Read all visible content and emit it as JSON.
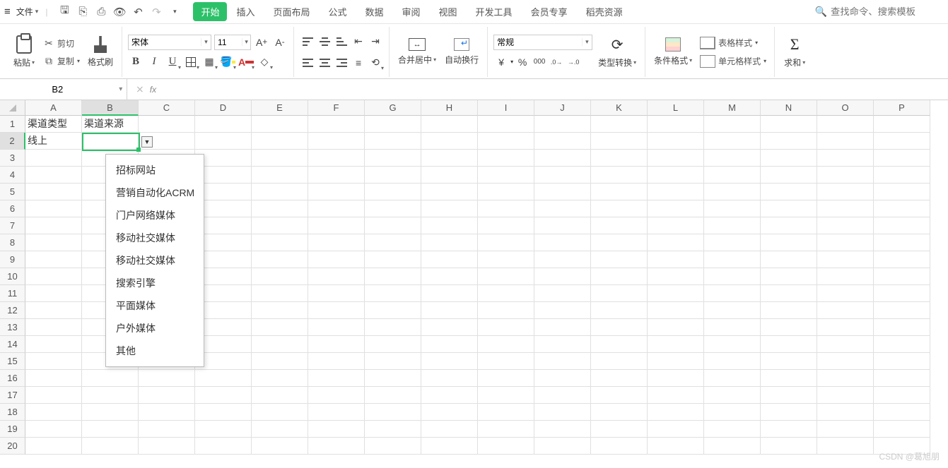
{
  "menu": {
    "file": "文件",
    "tabs": [
      "开始",
      "插入",
      "页面布局",
      "公式",
      "数据",
      "审阅",
      "视图",
      "开发工具",
      "会员专享",
      "稻壳资源"
    ],
    "activeTab": 0,
    "search_placeholder": "查找命令、搜索模板"
  },
  "ribbon": {
    "paste": "粘贴",
    "cut": "剪切",
    "copy": "复制",
    "formatPainter": "格式刷",
    "fontName": "宋体",
    "fontSize": "11",
    "mergeCenter": "合并居中",
    "wrapText": "自动换行",
    "numberFormat": "常规",
    "typeConvert": "类型转换",
    "condFormat": "条件格式",
    "tableStyle": "表格样式",
    "cellStyle": "单元格样式",
    "sum": "求和",
    "currency": "¥",
    "percent": "%",
    "comma": "000",
    "decInc": ".00→.0",
    "decDec": ".0→.00"
  },
  "namebox": "B2",
  "fx_label": "fx",
  "formula": "",
  "columns": [
    "A",
    "B",
    "C",
    "D",
    "E",
    "F",
    "G",
    "H",
    "I",
    "J",
    "K",
    "L",
    "M",
    "N",
    "O",
    "P"
  ],
  "rows": 20,
  "selectedCol": 1,
  "selectedRow": 1,
  "cellsData": {
    "A1": "渠道类型",
    "B1": "渠道来源",
    "A2": "线上"
  },
  "dropdown": {
    "items": [
      "招标网站",
      "营销自动化ACRM",
      "门户网络媒体",
      "移动社交媒体",
      "移动社交媒体",
      "搜索引擎",
      "平面媒体",
      "户外媒体",
      "其他"
    ]
  },
  "watermark": "CSDN @葛旭朋"
}
